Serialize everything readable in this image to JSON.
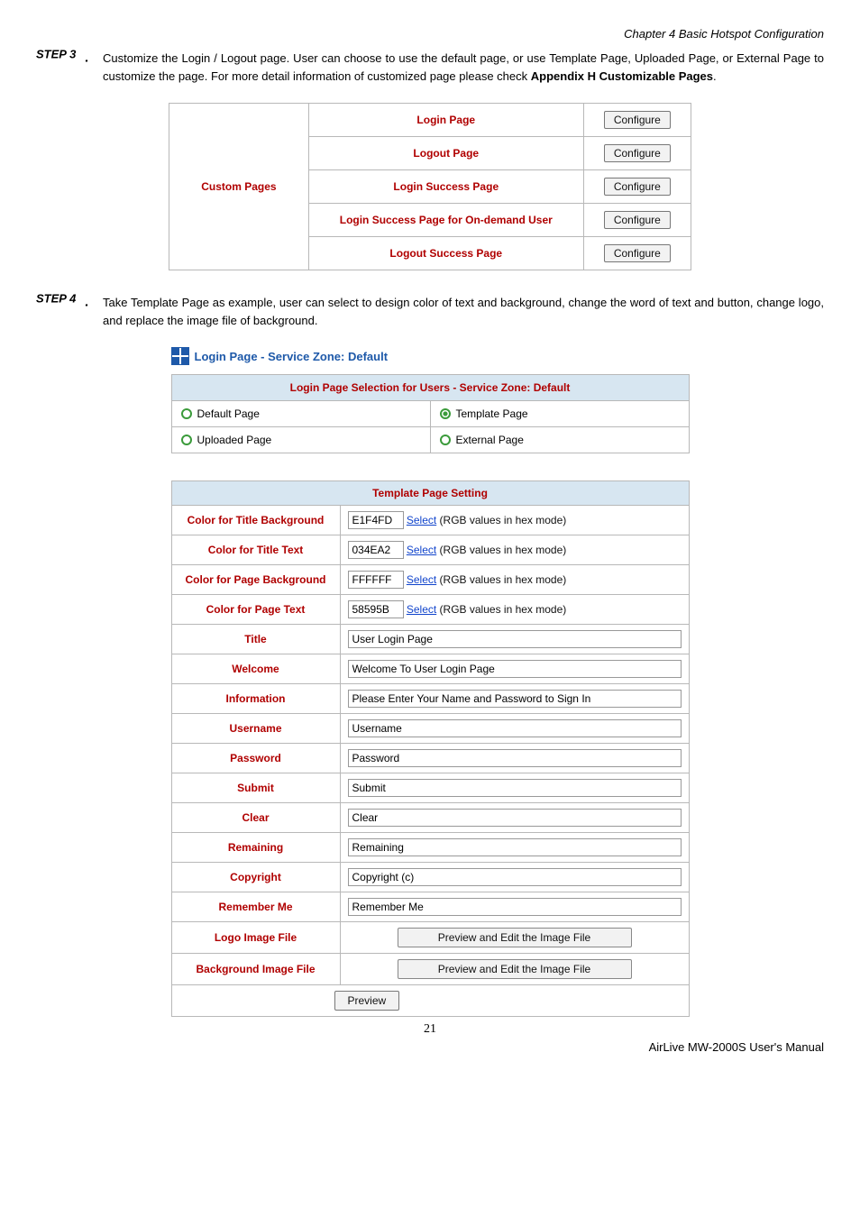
{
  "chapter_header": "Chapter 4 Basic Hotspot Configuration",
  "step3": {
    "label": "STEP 3",
    "text_1": "Customize the Login / Logout page. User can choose to use the default page, or use Template Page, Uploaded Page, or External Page to customize the page. For more detail information of customized page please check ",
    "appendix": "Appendix H Customizable Pages",
    "text_2": "."
  },
  "custom_pages": {
    "row_label": "Custom Pages",
    "rows": [
      {
        "name": "Login Page",
        "btn": "Configure"
      },
      {
        "name": "Logout Page",
        "btn": "Configure"
      },
      {
        "name": "Login Success Page",
        "btn": "Configure"
      },
      {
        "name": "Login Success Page for On-demand User",
        "btn": "Configure"
      },
      {
        "name": "Logout Success Page",
        "btn": "Configure"
      }
    ]
  },
  "step4": {
    "label": "STEP 4",
    "text": "Take Template Page as example, user can select to design color of text and background, change the word of text and button, change logo, and replace the image file of background."
  },
  "panel_title": "Login Page - Service Zone: Default",
  "selection": {
    "header": "Login Page Selection for Users - Service Zone: Default",
    "options": {
      "default": "Default Page",
      "template": "Template Page",
      "uploaded": "Uploaded Page",
      "external": "External Page"
    }
  },
  "template": {
    "header": "Template Page Setting",
    "select_label": "Select",
    "hex_hint": "(RGB values in hex mode)",
    "rows": {
      "title_bg": {
        "label": "Color for Title Background",
        "value": "E1F4FD"
      },
      "title_text": {
        "label": "Color for Title Text",
        "value": "034EA2"
      },
      "page_bg": {
        "label": "Color for Page Background",
        "value": "FFFFFF"
      },
      "page_text": {
        "label": "Color for Page Text",
        "value": "58595B"
      },
      "title": {
        "label": "Title",
        "value": "User Login Page"
      },
      "welcome": {
        "label": "Welcome",
        "value": "Welcome To User Login Page"
      },
      "information": {
        "label": "Information",
        "value": "Please Enter Your Name and Password to Sign In"
      },
      "username": {
        "label": "Username",
        "value": "Username"
      },
      "password": {
        "label": "Password",
        "value": "Password"
      },
      "submit": {
        "label": "Submit",
        "value": "Submit"
      },
      "clear": {
        "label": "Clear",
        "value": "Clear"
      },
      "remaining": {
        "label": "Remaining",
        "value": "Remaining"
      },
      "copyright": {
        "label": "Copyright",
        "value": "Copyright (c)"
      },
      "remember": {
        "label": "Remember Me",
        "value": "Remember Me"
      },
      "logo": {
        "label": "Logo Image File",
        "btn": "Preview and Edit the Image File"
      },
      "bgimage": {
        "label": "Background Image File",
        "btn": "Preview and Edit the Image File"
      }
    },
    "preview_btn": "Preview"
  },
  "page_number": "21",
  "footer": "AirLive MW-2000S User's Manual"
}
